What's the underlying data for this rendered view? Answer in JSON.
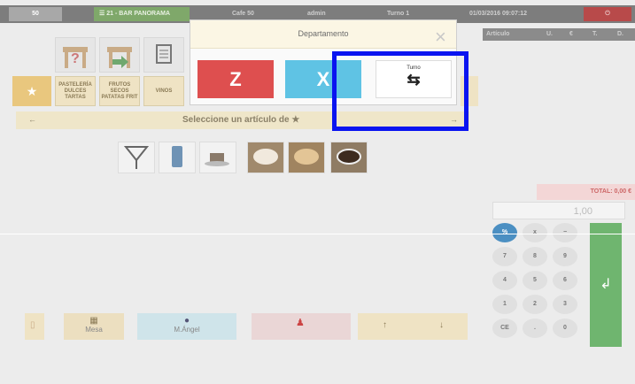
{
  "topbar": {
    "user_code": "50",
    "table": "21 - BAR PANORAMA",
    "cafe": "Cafe 50",
    "user": "admin",
    "turno": "Turno 1",
    "datetime": "01/03/2016 09:07:12",
    "power_icon": "power-icon"
  },
  "order_table": {
    "headers": [
      "Artículo",
      "U.",
      "€",
      "T.",
      "D."
    ]
  },
  "categories": [
    {
      "label": "PASTELERÍA DULCES TARTAS"
    },
    {
      "label": "FRUTOS SECOS PATATAS FRIT"
    },
    {
      "label": "VINOS"
    }
  ],
  "article_bar": {
    "text": "Seleccione un artículo de ★",
    "left": "←",
    "right": "→"
  },
  "total": {
    "label": "TOTAL: 0,00 €",
    "display": "1,00"
  },
  "keypad": {
    "keys": [
      "%",
      "x",
      "−",
      "7",
      "8",
      "9",
      "4",
      "5",
      "6",
      "1",
      "2",
      "3",
      "CE",
      ".",
      "0"
    ]
  },
  "bottom": {
    "item1": "Mesa",
    "item2": "M.Ángel",
    "arrow_up": "↑",
    "arrow_down": "↓"
  },
  "modal": {
    "title": "Departamento",
    "close": "×",
    "z_label": "Z",
    "x_label": "X",
    "turno_label": "Turno",
    "turno_icon": "⇆"
  },
  "colors": {
    "z": "#de4f4f",
    "x": "#5fc3e4",
    "highlight": "#0a14f0",
    "ok": "#6fb56f"
  }
}
